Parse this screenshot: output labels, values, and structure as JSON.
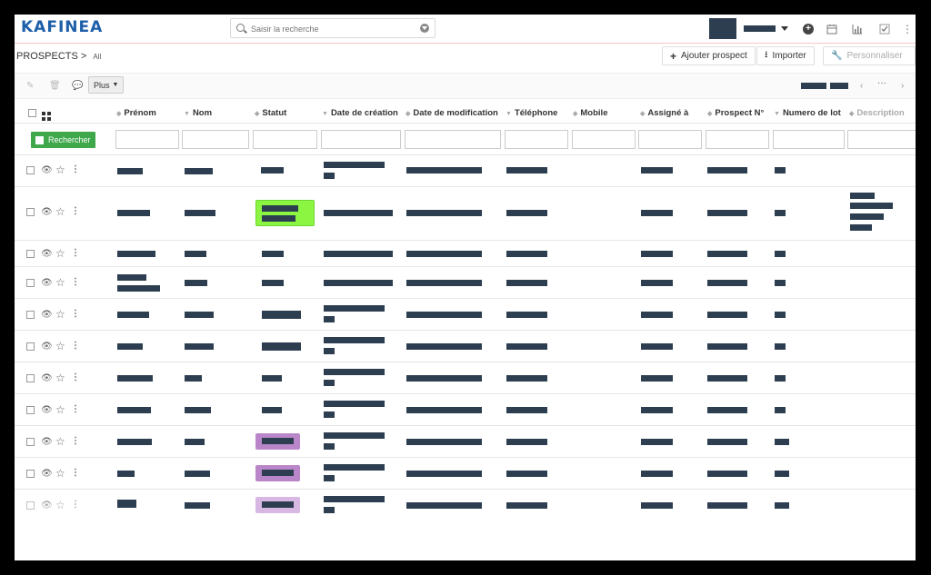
{
  "app": {
    "logo": "KAFINEA"
  },
  "search": {
    "placeholder": "Saisir la recherche"
  },
  "breadcrumb": {
    "module": "PROSPECTS",
    "separator": ">",
    "view": "All"
  },
  "actions": {
    "add_prospect": "Ajouter prospect",
    "import": "Importer",
    "customize": "Personnaliser"
  },
  "toolbar": {
    "more_label": "Plus"
  },
  "columns": [
    "Prénom",
    "Nom",
    "Statut",
    "Date de création",
    "Date de modification",
    "Téléphone",
    "Mobile",
    "Assigné à",
    "Prospect N°",
    "Numero de lot",
    "Description"
  ],
  "filter": {
    "search_button": "Rechercher"
  },
  "colors": {
    "accent": "#1d5fa8",
    "search_green": "#3ea84a",
    "status_green": "#8cf542",
    "status_purple": "#b987c9",
    "redacted": "#2c3e50"
  },
  "icons": [
    "search-icon",
    "chevron-down-icon",
    "plus-circle-icon",
    "calendar-icon",
    "chart-icon",
    "check-icon",
    "pencil-icon",
    "trash-icon",
    "comment-icon",
    "eye-icon",
    "star-icon",
    "more-vertical-icon",
    "grid-icon",
    "sort-icon",
    "wrench-icon",
    "download-icon"
  ]
}
